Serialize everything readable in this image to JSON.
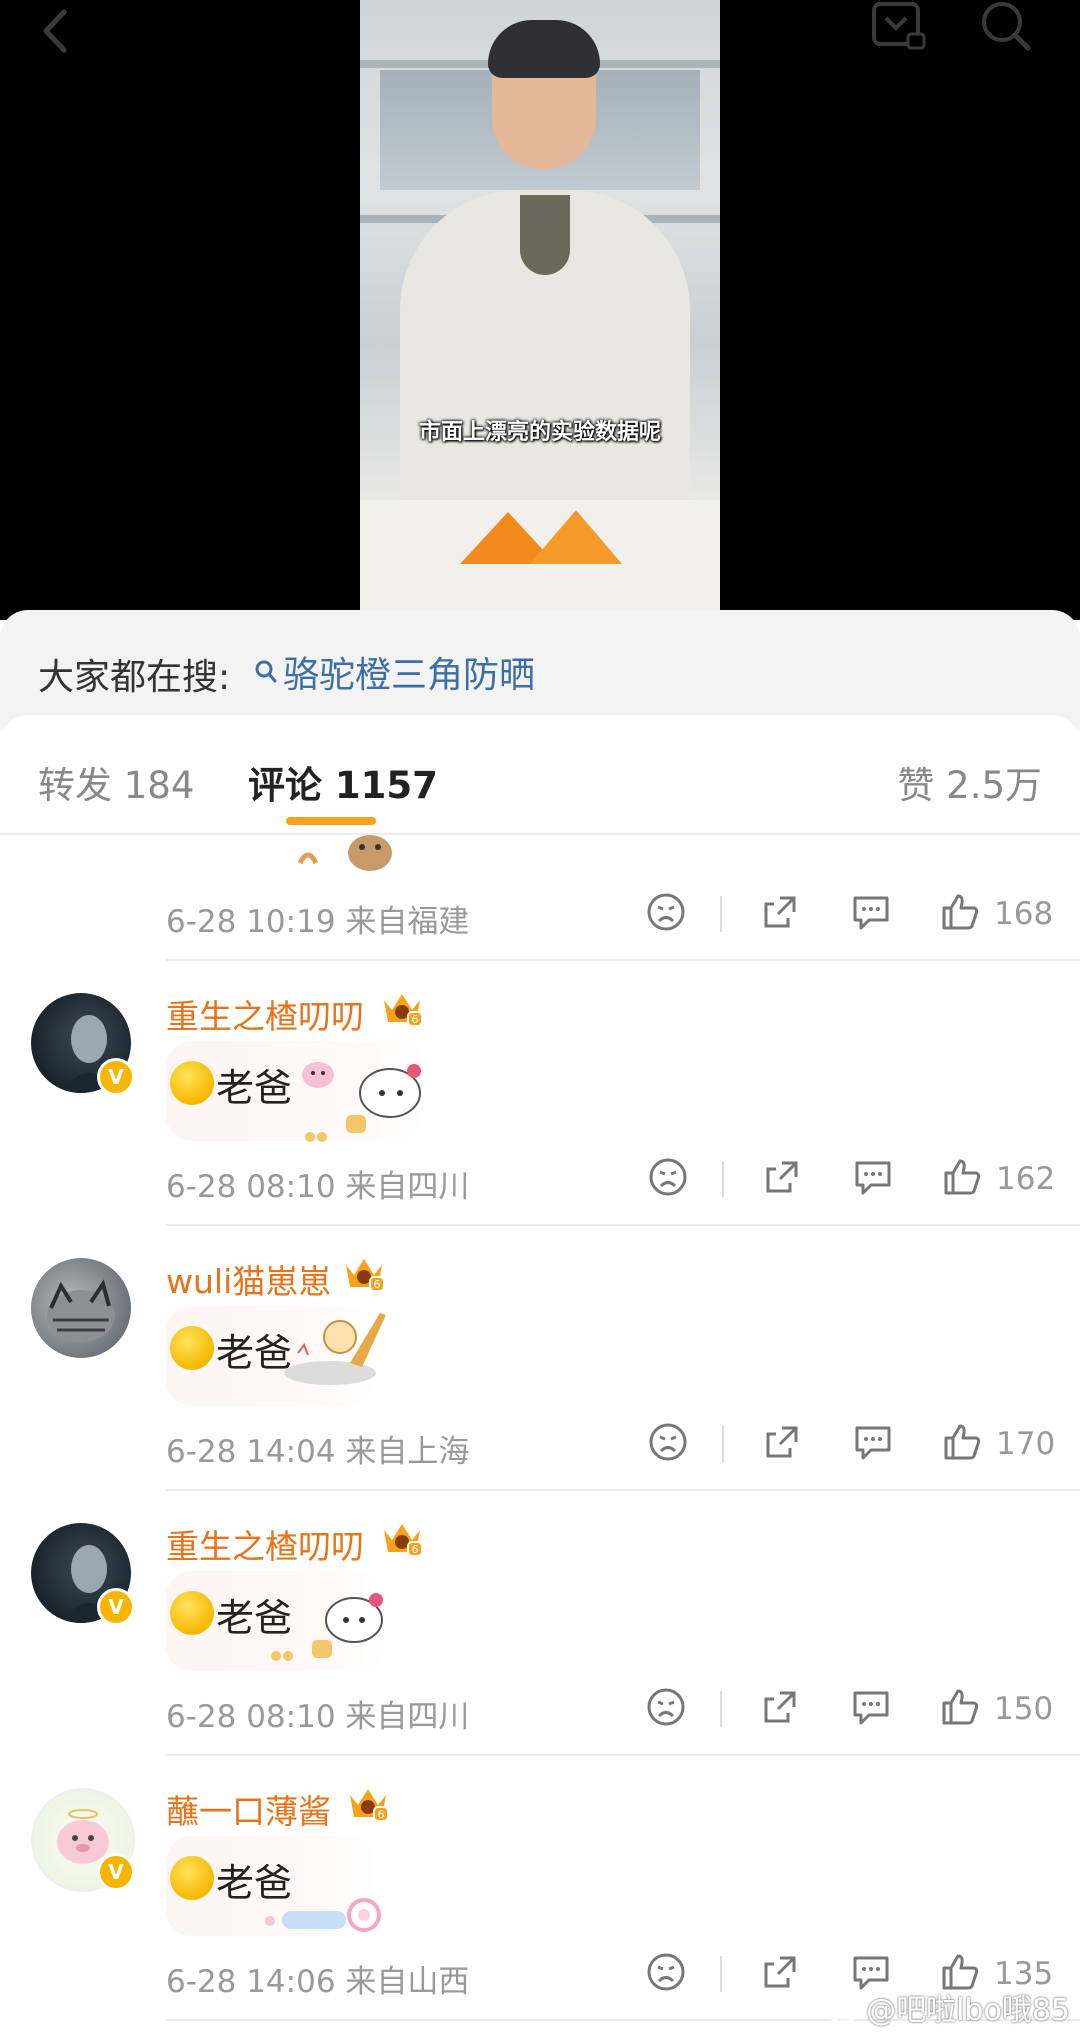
{
  "video": {
    "subtitle": "市面上漂亮的实验数据呢",
    "icons": [
      "back-icon",
      "download-icon",
      "search-icon"
    ]
  },
  "search": {
    "label": "大家都在搜:",
    "query": "骆驼橙三角防晒"
  },
  "tabs": {
    "repost": "转发 184",
    "comments": "评论 1157",
    "likes": "赞 2.5万"
  },
  "comments": [
    {
      "meta": "6-28 10:19  来自福建",
      "likes": "168"
    },
    {
      "user": "重生之楂叨叨",
      "text": "老爸",
      "meta": "6-28 08:10  来自四川",
      "likes": "162"
    },
    {
      "user": "wuli猫崽崽",
      "text": "老爸",
      "meta": "6-28 14:04  来自上海",
      "likes": "170"
    },
    {
      "user": "重生之楂叨叨",
      "text": "老爸",
      "meta": "6-28 08:10  来自四川",
      "likes": "150"
    },
    {
      "user": "蘸一口薄酱",
      "text": "老爸",
      "meta": "6-28 14:06  来自山西",
      "likes": "135"
    }
  ],
  "badges": {
    "verified": "V",
    "crown_level": "6"
  },
  "watermark": "@吧啦lbo哦85",
  "colors": {
    "accent": "#f7a21b",
    "username": "#e8731a",
    "link": "#3d6fa6"
  }
}
